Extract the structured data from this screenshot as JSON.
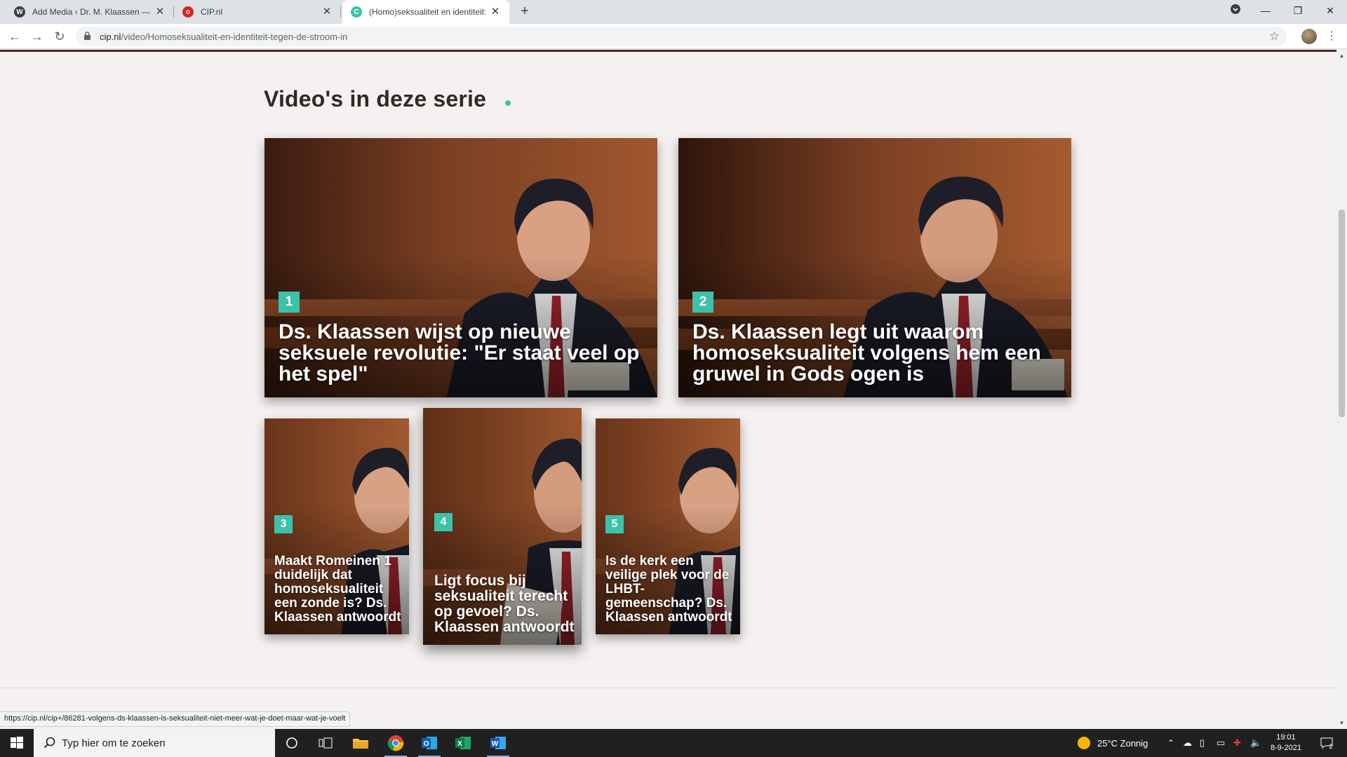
{
  "browser": {
    "tabs": [
      {
        "title": "Add Media ‹ Dr. M. Klaassen — WordPress",
        "active": false,
        "favicon": "wordpress-icon"
      },
      {
        "title": "CIP.nl",
        "active": false,
        "favicon": "cip-icon"
      },
      {
        "title": "(Homo)seksualiteit en identiteit: tegen de stroom in",
        "active": true,
        "favicon": "cip-c-icon"
      }
    ],
    "new_tab_label": "+",
    "url_host": "cip.nl",
    "url_path": "/video/Homoseksualiteit-en-identiteit-tegen-de-stroom-in",
    "status_url": "https://cip.nl/cip+/86281-volgens-ds-klaassen-is-seksualiteit-niet-meer-wat-je-doet-maar-wat-je-voelt"
  },
  "page": {
    "section_title": "Video's in deze serie",
    "accent_color": "#3cc2a8",
    "videos": [
      {
        "number": "1",
        "title": "Ds. Klaassen wijst op nieuwe seksuele revolutie: \"Er staat veel op het spel\""
      },
      {
        "number": "2",
        "title": "Ds. Klaassen legt uit waarom homoseksualiteit volgens hem een gruwel in Gods ogen is"
      },
      {
        "number": "3",
        "title": "Maakt Romeinen 1 duidelijk dat homoseksualiteit een zonde is? Ds. Klaassen antwoordt"
      },
      {
        "number": "4",
        "title": "Ligt focus bij seksualiteit terecht op gevoel? Ds. Klaassen antwoordt"
      },
      {
        "number": "5",
        "title": "Is de kerk een veilige plek voor de LHBT-gemeenschap? Ds. Klaassen antwoordt"
      }
    ]
  },
  "taskbar": {
    "search_placeholder": "Typ hier om te zoeken",
    "weather": "25°C  Zonnig",
    "time": "19:01",
    "date": "8-9-2021",
    "notification_count": "2"
  }
}
